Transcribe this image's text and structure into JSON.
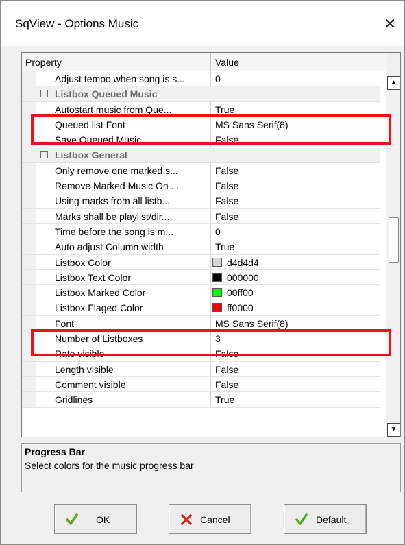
{
  "window": {
    "title": "SqView - Options Music",
    "close_glyph": "✕"
  },
  "grid": {
    "header": {
      "property": "Property",
      "value": "Value"
    },
    "rows": [
      {
        "type": "prop",
        "name": "Adjust tempo when song is s...",
        "value": "0"
      },
      {
        "type": "cat",
        "toggle": "−",
        "name": "Listbox Queued Music"
      },
      {
        "type": "prop",
        "name": "Autostart music from Que...",
        "value": "True"
      },
      {
        "type": "prop",
        "name": "Queued list Font",
        "value": "MS Sans Serif(8)"
      },
      {
        "type": "prop",
        "name": "Save Queued Music",
        "value": "False"
      },
      {
        "type": "cat",
        "toggle": "−",
        "name": "Listbox General"
      },
      {
        "type": "prop",
        "name": "Only remove one marked s...",
        "value": "False"
      },
      {
        "type": "prop",
        "name": "Remove Marked Music On ...",
        "value": "False"
      },
      {
        "type": "prop",
        "name": "Using marks from all listb...",
        "value": "False"
      },
      {
        "type": "prop",
        "name": "Marks shall be playlist/dir...",
        "value": "False"
      },
      {
        "type": "prop",
        "name": "Time before the song is m...",
        "value": "0"
      },
      {
        "type": "prop",
        "name": "Auto adjust Column width",
        "value": "True"
      },
      {
        "type": "color",
        "name": "Listbox Color",
        "value": "d4d4d4",
        "color": "#d4d4d4"
      },
      {
        "type": "color",
        "name": "Listbox Text Color",
        "value": "000000",
        "color": "#000000"
      },
      {
        "type": "color",
        "name": "Listbox Marked Color",
        "value": "00ff00",
        "color": "#00ff00"
      },
      {
        "type": "color",
        "name": "Listbox Flaged Color",
        "value": "ff0000",
        "color": "#ff0000"
      },
      {
        "type": "prop",
        "name": "Font",
        "value": "MS Sans Serif(8)"
      },
      {
        "type": "prop",
        "name": "Number of Listboxes",
        "value": "3"
      },
      {
        "type": "prop",
        "name": "Rate visible",
        "value": "False"
      },
      {
        "type": "prop",
        "name": "Length visible",
        "value": "False"
      },
      {
        "type": "prop",
        "name": "Comment visible",
        "value": "False"
      },
      {
        "type": "prop",
        "name": "Gridlines",
        "value": "True"
      }
    ]
  },
  "scrollbar": {
    "up_glyph": "▲",
    "down_glyph": "▼"
  },
  "description": {
    "title": "Progress Bar",
    "text": "Select colors for the music progress bar"
  },
  "buttons": {
    "ok": "OK",
    "cancel": "Cancel",
    "default": "Default"
  },
  "colors": {
    "highlight": "#e8141b",
    "check": "#5aa51c",
    "cross": "#d12a1f"
  }
}
